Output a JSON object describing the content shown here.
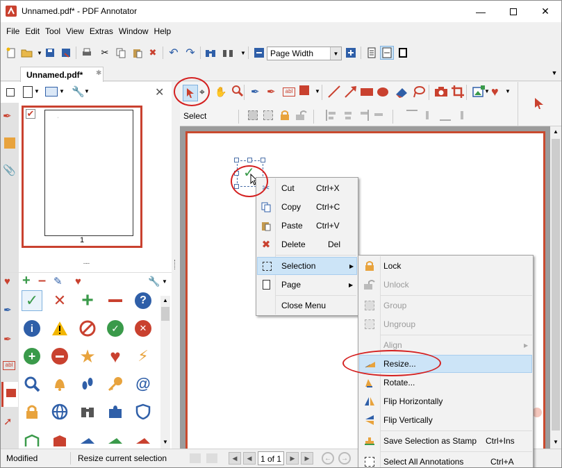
{
  "window": {
    "title": "Unnamed.pdf* - PDF Annotator"
  },
  "menubar": {
    "items": [
      "File",
      "Edit",
      "Tool",
      "View",
      "Extras",
      "Window",
      "Help"
    ]
  },
  "toolbar": {
    "zoom_value": "Page Width"
  },
  "tabs": {
    "doc_tab": "Unnamed.pdf*",
    "close_glyph": "✱"
  },
  "thumbnails": {
    "page_number": "1",
    "splitter_dots": "....."
  },
  "annotation_bar": {
    "select_label": "Select"
  },
  "context_menu": {
    "items": [
      {
        "label": "Cut",
        "shortcut": "Ctrl+X",
        "icon": "scissors-icon"
      },
      {
        "label": "Copy",
        "shortcut": "Ctrl+C",
        "icon": "copy-icon"
      },
      {
        "label": "Paste",
        "shortcut": "Ctrl+V",
        "icon": "paste-icon"
      },
      {
        "label": "Delete",
        "shortcut": "Del",
        "icon": "delete-icon"
      },
      {
        "label": "Selection",
        "shortcut": "",
        "icon": "selection-icon"
      },
      {
        "label": "Page",
        "shortcut": "",
        "icon": "page-icon"
      },
      {
        "label": "Close Menu",
        "shortcut": "",
        "icon": ""
      }
    ]
  },
  "submenu": {
    "items": [
      {
        "label": "Lock",
        "shortcut": "",
        "icon": "lock-icon",
        "enabled": true
      },
      {
        "label": "Unlock",
        "shortcut": "",
        "icon": "unlock-icon",
        "enabled": false
      },
      {
        "label": "Group",
        "shortcut": "",
        "icon": "group-icon",
        "enabled": false
      },
      {
        "label": "Ungroup",
        "shortcut": "",
        "icon": "ungroup-icon",
        "enabled": false
      },
      {
        "label": "Align",
        "shortcut": "",
        "icon": "",
        "enabled": false
      },
      {
        "label": "Resize...",
        "shortcut": "",
        "icon": "resize-icon",
        "enabled": true
      },
      {
        "label": "Rotate...",
        "shortcut": "",
        "icon": "rotate-icon",
        "enabled": true
      },
      {
        "label": "Flip Horizontally",
        "shortcut": "",
        "icon": "flip-horizontal-icon",
        "enabled": true
      },
      {
        "label": "Flip Vertically",
        "shortcut": "",
        "icon": "flip-vertical-icon",
        "enabled": true
      },
      {
        "label": "Save Selection as Stamp",
        "shortcut": "Ctrl+Ins",
        "icon": "stamp-icon",
        "enabled": true
      },
      {
        "label": "Select All Annotations",
        "shortcut": "Ctrl+A",
        "icon": "select-all-icon",
        "enabled": true
      }
    ]
  },
  "statusbar": {
    "mode": "Modified",
    "message": "Resize current selection",
    "page_indicator": "1 of 1"
  },
  "colors": {
    "accent_red": "#c9412f",
    "highlight": "#cce4f7"
  }
}
